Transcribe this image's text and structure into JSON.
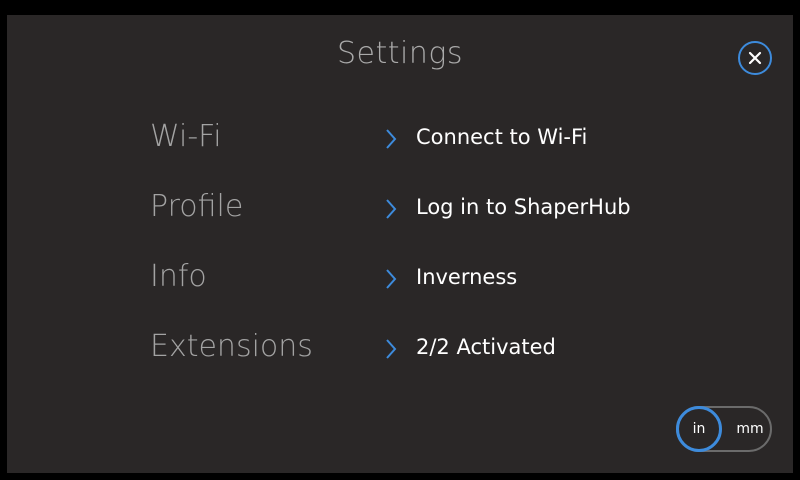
{
  "header": {
    "title": "Settings",
    "close_icon": "close-icon",
    "accent_color": "#3d8bdc"
  },
  "settings": {
    "rows": [
      {
        "label": "Wi-Fi",
        "value": "Connect to Wi-Fi",
        "icon": "chevron-right-icon"
      },
      {
        "label": "Profile",
        "value": "Log in to ShaperHub",
        "icon": "chevron-right-icon"
      },
      {
        "label": "Info",
        "value": "Inverness",
        "icon": "chevron-right-icon"
      },
      {
        "label": "Extensions",
        "value": "2/2 Activated",
        "icon": "chevron-right-icon"
      }
    ]
  },
  "units": {
    "options": [
      "in",
      "mm"
    ],
    "selected": "in"
  }
}
